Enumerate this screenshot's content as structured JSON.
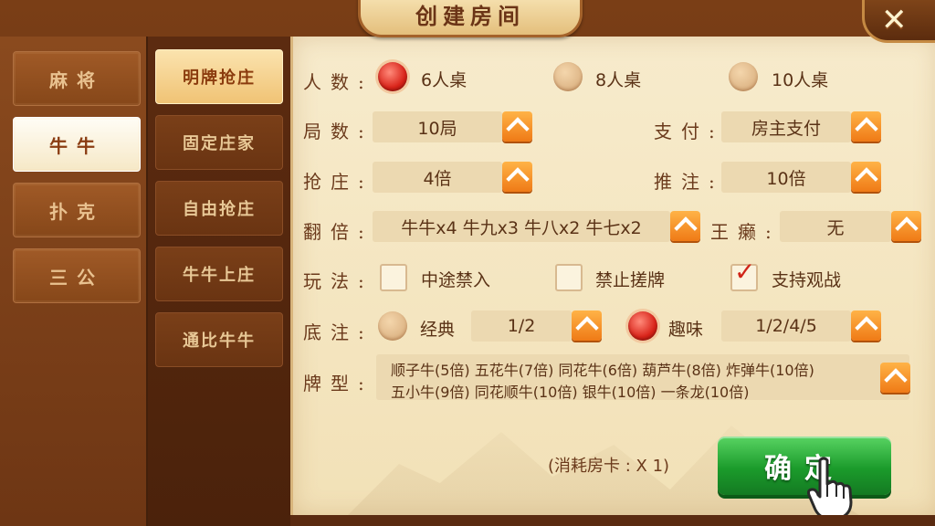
{
  "window": {
    "title": "创建房间"
  },
  "close_icon": "✕",
  "game_tabs": [
    {
      "label": "麻将",
      "active": false
    },
    {
      "label": "牛牛",
      "active": true
    },
    {
      "label": "扑克",
      "active": false
    },
    {
      "label": "三公",
      "active": false
    }
  ],
  "mode_tabs": [
    {
      "label": "明牌抢庄",
      "active": true
    },
    {
      "label": "固定庄家",
      "active": false
    },
    {
      "label": "自由抢庄",
      "active": false
    },
    {
      "label": "牛牛上庄",
      "active": false
    },
    {
      "label": "通比牛牛",
      "active": false
    }
  ],
  "form": {
    "players": {
      "label": "人数:",
      "options": [
        "6人桌",
        "8人桌",
        "10人桌"
      ],
      "selected": "6人桌"
    },
    "rounds": {
      "label": "局数:",
      "value": "10局"
    },
    "payment": {
      "label": "支付:",
      "value": "房主支付"
    },
    "banker": {
      "label": "抢庄:",
      "value": "4倍"
    },
    "push_bet": {
      "label": "推注:",
      "value": "10倍"
    },
    "multiplier": {
      "label": "翻倍:",
      "value": "牛牛x4 牛九x3 牛八x2 牛七x2"
    },
    "wildcard": {
      "label": "王癞:",
      "value": "无"
    },
    "rules": {
      "label": "玩法:",
      "options": [
        {
          "label": "中途禁入",
          "checked": false
        },
        {
          "label": "禁止搓牌",
          "checked": false
        },
        {
          "label": "支持观战",
          "checked": true
        }
      ]
    },
    "base_bet": {
      "label": "底注:",
      "classic_label": "经典",
      "classic_value": "1/2",
      "classic_selected": false,
      "fun_label": "趣味",
      "fun_value": "1/2/4/5",
      "fun_selected": true
    },
    "card_types": {
      "label": "牌型:",
      "line1": "顺子牛(5倍) 五花牛(7倍) 同花牛(6倍) 葫芦牛(8倍) 炸弹牛(10倍)",
      "line2": "五小牛(9倍) 同花顺牛(10倍) 银牛(10倍) 一条龙(10倍)"
    }
  },
  "footer": {
    "cost_text": "(消耗房卡 : X 1)",
    "confirm_label": "确定"
  },
  "colors": {
    "accent_orange": "#ef7a16",
    "confirm_green": "#1b9b2b",
    "radio_selected": "#d9241a"
  }
}
